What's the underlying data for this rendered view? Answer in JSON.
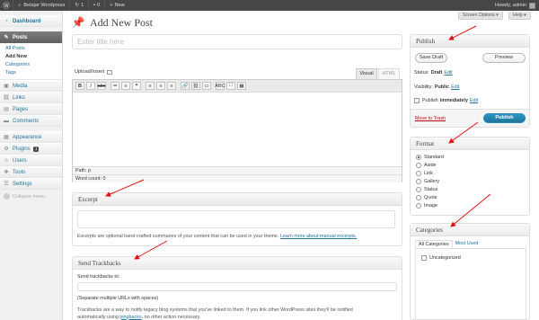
{
  "admin_bar": {
    "site_name": "Belajar Wordpress",
    "updates_count": "1",
    "comments_count": "0",
    "new_label": "New",
    "greeting": "Howdy, admin"
  },
  "screen_options": {
    "screen_options_label": "Screen Options ▾",
    "help_label": "Help ▾"
  },
  "sidebar": {
    "dashboard": "Dashboard",
    "posts": "Posts",
    "posts_submenu": [
      "All Posts",
      "Add New",
      "Categories",
      "Tags"
    ],
    "media": "Media",
    "links": "Links",
    "pages": "Pages",
    "comments": "Comments",
    "appearance": "Appearance",
    "plugins": "Plugins",
    "plugins_badge": "1",
    "users": "Users",
    "tools": "Tools",
    "settings": "Settings",
    "collapse": "Collapse menu"
  },
  "page": {
    "title": "Add New Post",
    "title_placeholder": "Enter title here"
  },
  "editor": {
    "upload_insert": "Upload/Insert",
    "tab_visual": "Visual",
    "tab_html": "HTML",
    "toolbar_buttons": [
      "B",
      "I",
      "abc",
      "≔",
      "≡",
      "❝",
      "≡",
      "≡",
      "≡",
      "🔗",
      "⛓",
      "▭",
      "ABC",
      "⛶",
      "▦"
    ],
    "path_label": "Path: p",
    "word_count": "Word count: 0"
  },
  "excerpt": {
    "heading": "Excerpt",
    "help_text": "Excerpts are optional hand-crafted summaries of your content that can be used in your theme.",
    "help_link": "Learn more about manual excerpts."
  },
  "trackbacks": {
    "heading": "Send Trackbacks",
    "label": "Send trackbacks to:",
    "note": "(Separate multiple URLs with spaces)",
    "description_1": "Trackbacks are a way to notify legacy blog systems that you've linked to them. If you link other WordPress sites they'll be notified",
    "description_2_prefix": "automatically using",
    "pingbacks_link": "pingbacks",
    "description_2_suffix": ", no other action necessary."
  },
  "publish": {
    "heading": "Publish",
    "save_draft": "Save Draft",
    "preview": "Preview",
    "status_label": "Status:",
    "status_value": "Draft",
    "visibility_label": "Visibility:",
    "visibility_value": "Public",
    "publish_label": "Publish",
    "publish_value": "immediately",
    "edit": "Edit",
    "trash": "Move to Trash",
    "publish_button": "Publish"
  },
  "format": {
    "heading": "Format",
    "options": [
      "Standard",
      "Aside",
      "Link",
      "Gallery",
      "Status",
      "Quote",
      "Image"
    ],
    "selected": "Standard"
  },
  "categories": {
    "heading": "Categories",
    "tab_all": "All Categories",
    "tab_most_used": "Most Used",
    "items": [
      "Uncategorized"
    ]
  },
  "colors": {
    "link": "#21759b",
    "publish_button": "#21759b",
    "trash": "#bc0b0b",
    "arrow": "#e01010",
    "admin_bar": "#464646"
  }
}
